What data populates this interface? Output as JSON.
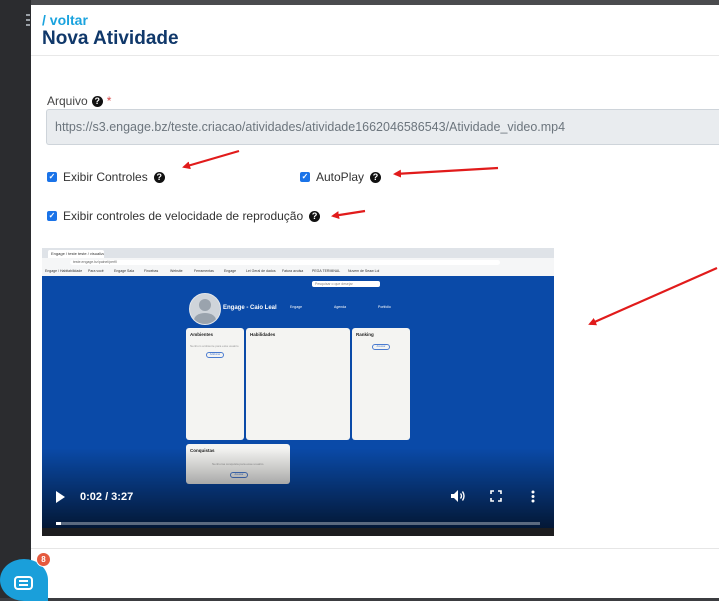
{
  "header": {
    "back_link": "/ voltar",
    "title": "Nova Atividade"
  },
  "form": {
    "file_label": "Arquivo",
    "required_mark": "*",
    "file_url": "https://s3.engage.bz/teste.criacao/atividades/atividade1662046586543/Atividade_video.mp4",
    "checkboxes": [
      {
        "label": "Exibir Controles",
        "checked": true
      },
      {
        "label": "AutoPlay",
        "checked": true
      },
      {
        "label": "Exibir controles de velocidade de reprodução",
        "checked": true
      }
    ]
  },
  "video": {
    "current_time": "0:02",
    "duration": "3:27",
    "time_display": "0:02 / 3:27",
    "progress_fraction": 0.01,
    "content": {
      "browser_tab": "Engage / teste teste / visualizar",
      "address": "teste.engage.bz/painel/perfil",
      "bookmarks": [
        "Engage / Habitabilidade",
        "Para você",
        "Engage Sala",
        "Fincebas",
        "Website",
        "Ferramentas",
        "Engage",
        "Lei Geral de dados",
        "Fatura avulsa",
        "PEGA TERMINAL",
        "Nuvem de Seaw Lol"
      ],
      "search_placeholder": "Pesquisar o que desejar",
      "profile_name": "Engage - Caio Leal",
      "links": [
        "Engage",
        "Agenda",
        "Portfolio"
      ],
      "cards": [
        {
          "title": "Ambientes",
          "text": "Nenhum ambiente para esta usuário",
          "button": "Adicionar"
        },
        {
          "title": "Habilidades",
          "text": "",
          "button": ""
        },
        {
          "title": "Ranking",
          "text": "",
          "button": "Acessar"
        },
        {
          "title": "Conquistas",
          "text": "Nenhuma conquista para esse usuário",
          "button": "Acessar"
        }
      ]
    }
  },
  "chat": {
    "badge_count": "8"
  },
  "colors": {
    "accent": "#1aa3de",
    "title": "#10386a",
    "checkbox": "#1a73e8",
    "annotation_arrow": "#e11b1b",
    "video_bg": "#0a4aa8"
  }
}
